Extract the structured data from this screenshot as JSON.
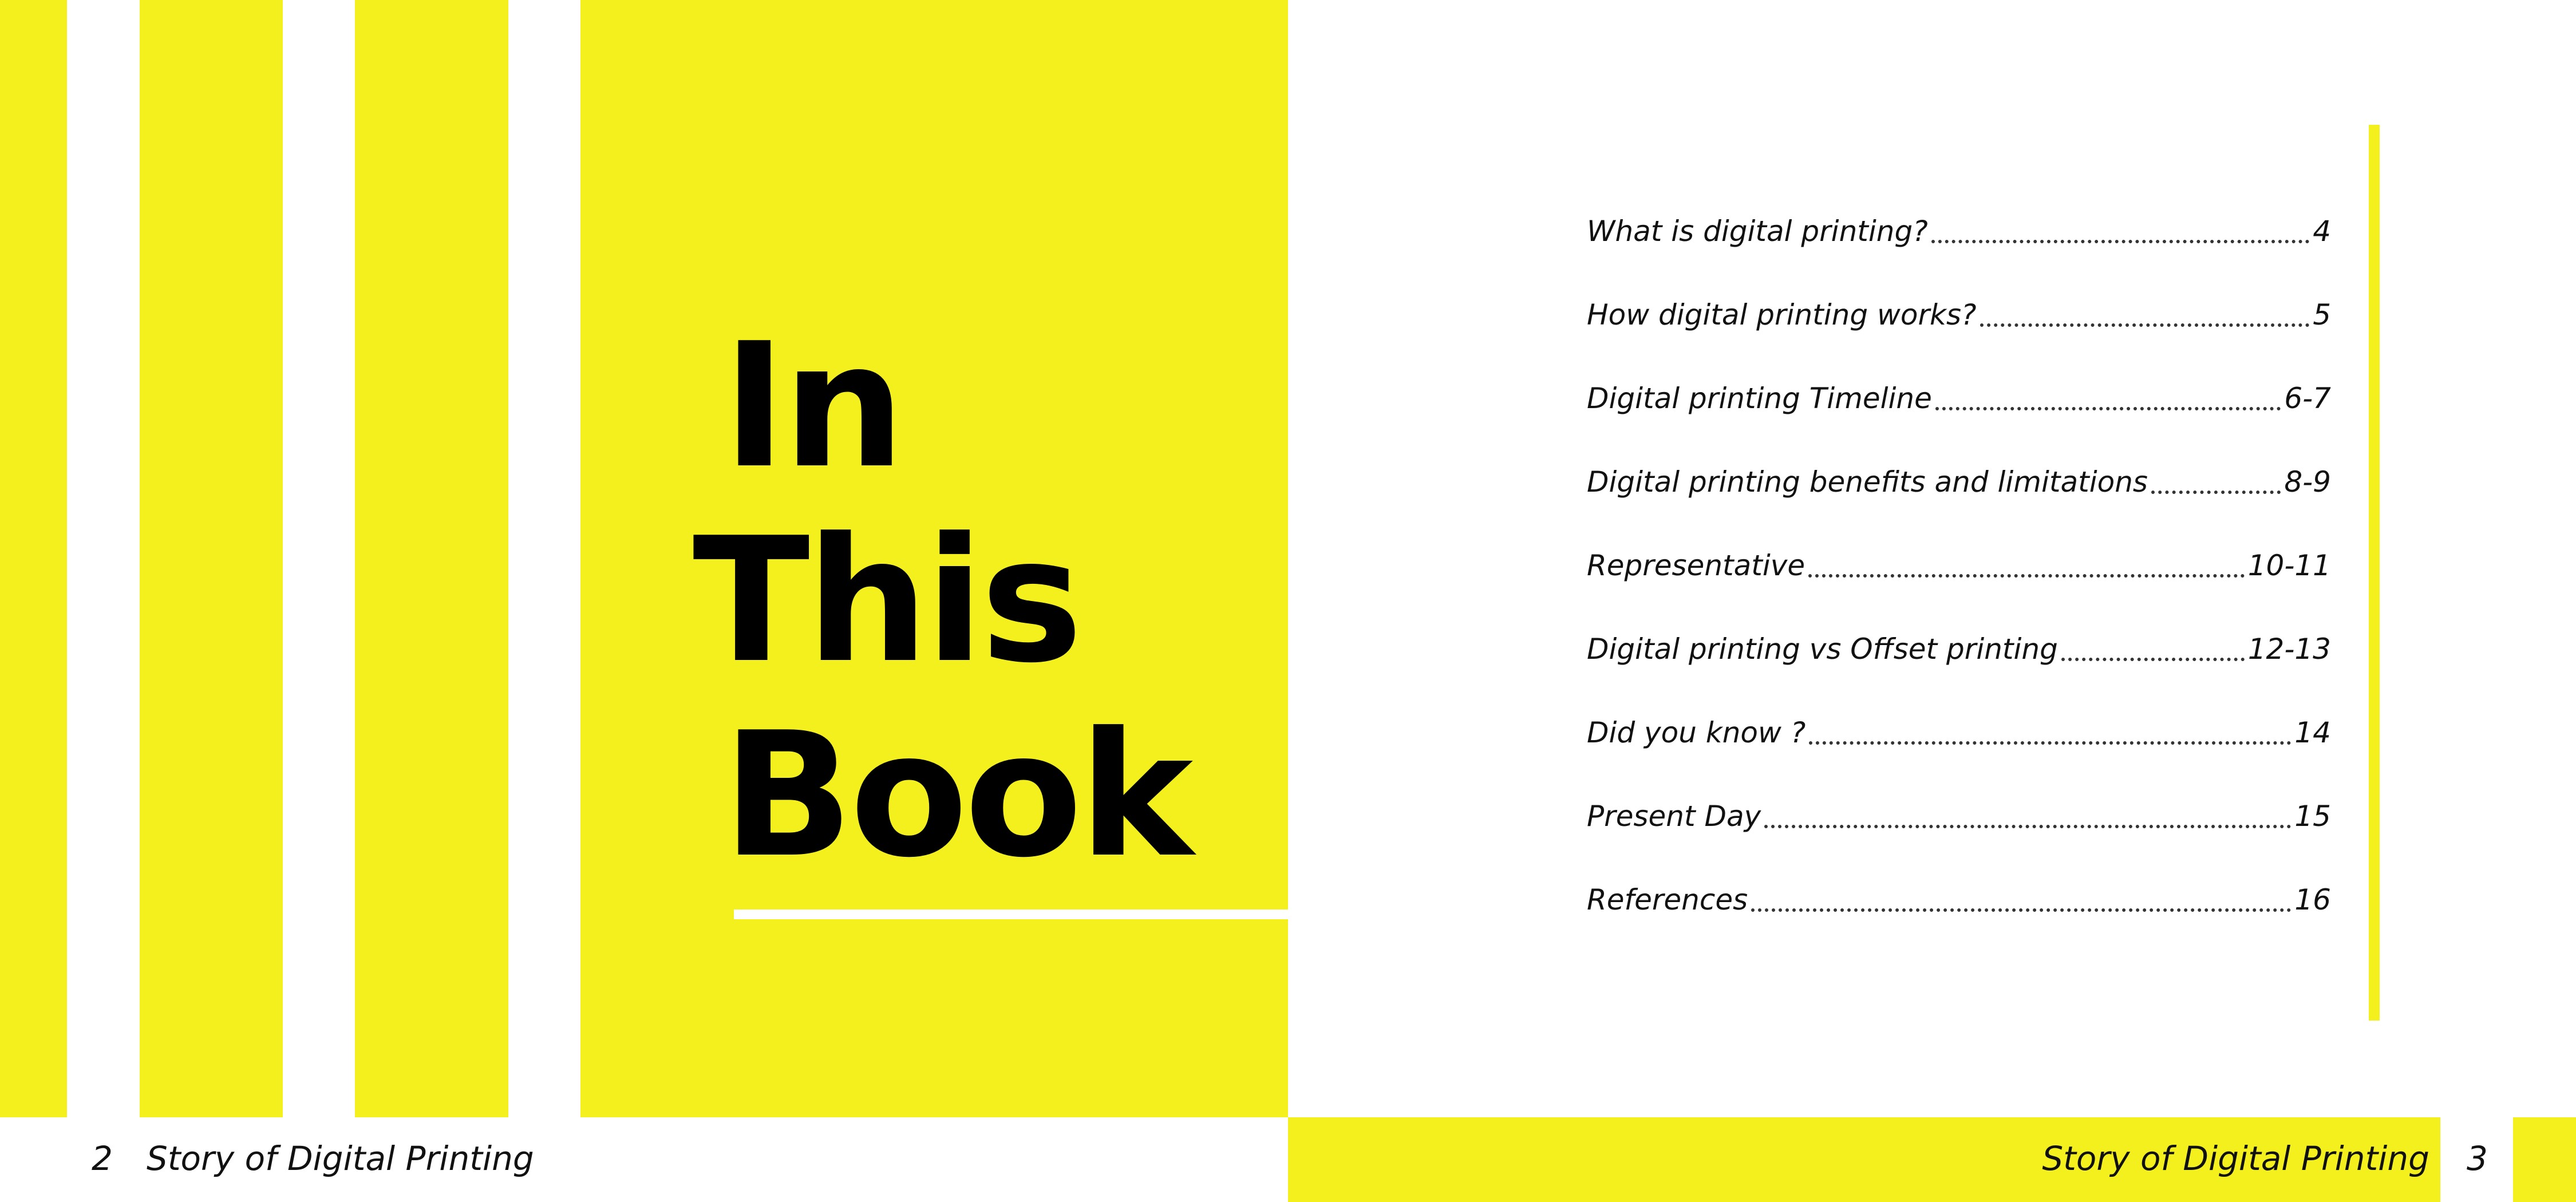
{
  "title": {
    "line1": "In",
    "line2": "This",
    "line3": "Book"
  },
  "toc": [
    {
      "title": "What is digital printing?",
      "page": "4"
    },
    {
      "title": "How digital printing works?",
      "page": "5"
    },
    {
      "title": "Digital printing Timeline",
      "page": "6-7"
    },
    {
      "title": "Digital printing benefits and limitations",
      "page": "8-9"
    },
    {
      "title": "Representative",
      "page": "10-11"
    },
    {
      "title": "Digital printing vs Offset printing",
      "page": "12-13"
    },
    {
      "title": "Did you know ?",
      "page": "14"
    },
    {
      "title": "Present Day",
      "page": "15"
    },
    {
      "title": "References",
      "page": "16"
    }
  ],
  "footer": {
    "left_page_number": "2",
    "left_title": "Story of Digital Printing",
    "right_title": "Story of Digital Printing",
    "right_page_number": "3"
  },
  "colors": {
    "accent": "#f3f01e",
    "text": "#111111",
    "background": "#ffffff"
  }
}
